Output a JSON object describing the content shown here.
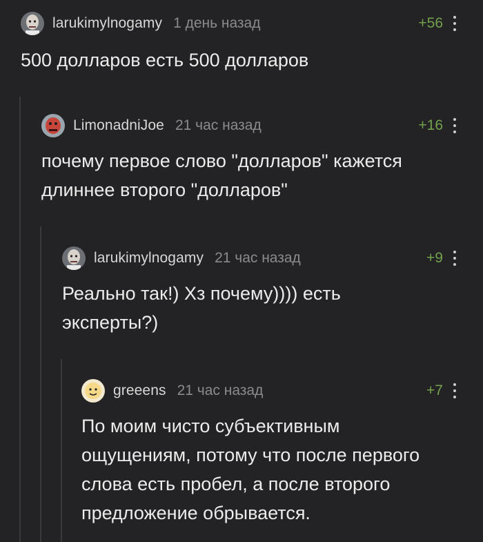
{
  "comments": [
    {
      "user": "larukimylnogamy",
      "time": "1 день назад",
      "rating": "+56",
      "text": "500 долларов есть 500 долларов",
      "avatar": "bald-man-photo"
    },
    {
      "user": "LimonadniJoe",
      "time": "21 час назад",
      "rating": "+16",
      "text": "почему первое слово \"долларов\" кажется\nдлиннее второго \"долларов\"",
      "avatar": "red-face-photo"
    },
    {
      "user": "larukimylnogamy",
      "time": "21 час назад",
      "rating": "+9",
      "text": "Реально так!) Хз почему)))) есть\nэксперты?)",
      "avatar": "bald-man-photo"
    },
    {
      "user": "greeens",
      "time": "21 час назад",
      "rating": "+7",
      "text": "По моим чисто субъективным\nощущениям, потому что после первого\nслова есть пробел, а после второго\nпредложение обрывается.",
      "avatar": "cartoon-face"
    }
  ],
  "colors": {
    "background": "#232325",
    "rating_positive": "#73a14c",
    "thread_line": "#3a3a3d"
  }
}
